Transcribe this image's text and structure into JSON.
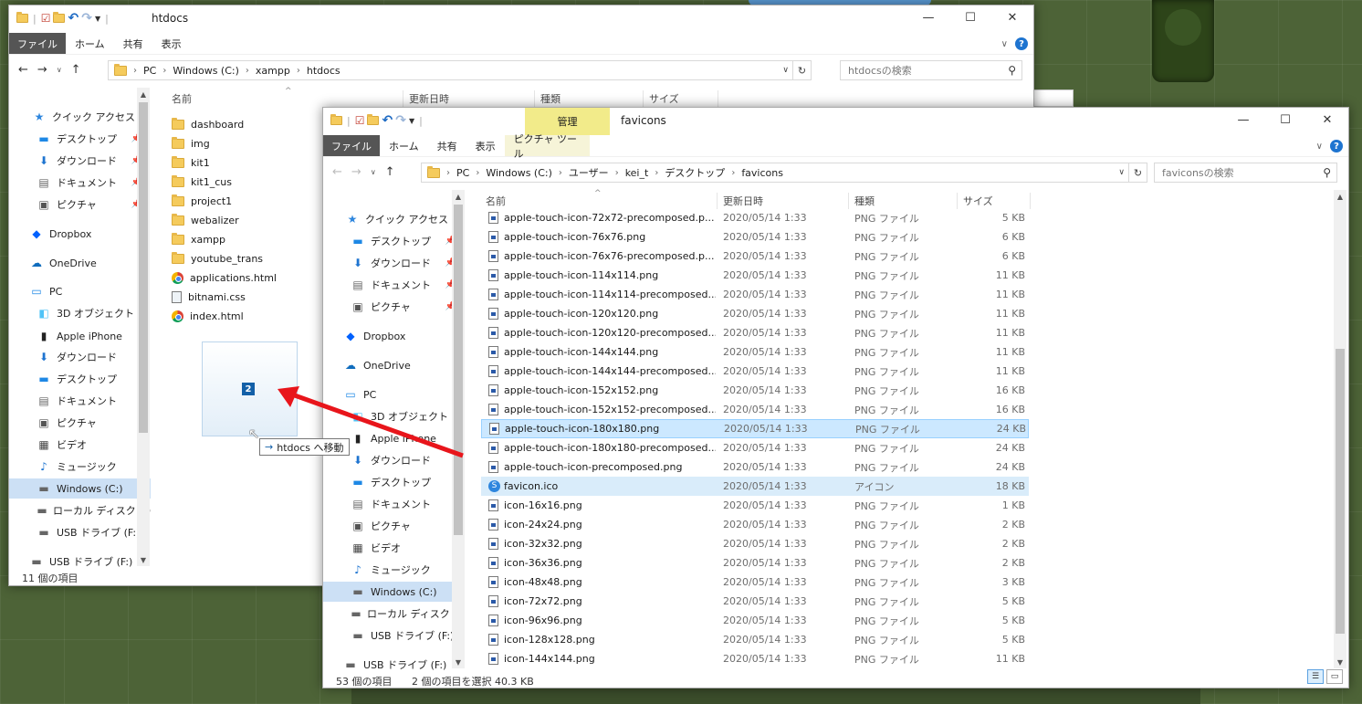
{
  "window_back": {
    "title": "htdocs",
    "ribbon_tabs": [
      "ファイル",
      "ホーム",
      "共有",
      "表示"
    ],
    "breadcrumb": [
      "PC",
      "Windows (C:)",
      "xampp",
      "htdocs"
    ],
    "search_placeholder": "htdocsの検索",
    "columns": [
      "名前",
      "更新日時",
      "種類",
      "サイズ"
    ],
    "nav": [
      {
        "label": "クイック アクセス",
        "icon": "star-icon",
        "pinned": false
      },
      {
        "label": "デスクトップ",
        "icon": "desktop-icon",
        "pinned": true
      },
      {
        "label": "ダウンロード",
        "icon": "download-icon",
        "pinned": true
      },
      {
        "label": "ドキュメント",
        "icon": "document-icon",
        "pinned": true
      },
      {
        "label": "ピクチャ",
        "icon": "picture-icon",
        "pinned": true
      },
      {
        "label": "Dropbox",
        "icon": "dropbox-icon",
        "pinned": false
      },
      {
        "label": "OneDrive",
        "icon": "onedrive-icon",
        "pinned": false
      },
      {
        "label": "PC",
        "icon": "pc-icon",
        "pinned": false
      },
      {
        "label": "3D オブジェクト",
        "icon": "cube-icon",
        "pinned": false
      },
      {
        "label": "Apple iPhone",
        "icon": "phone-icon",
        "pinned": false
      },
      {
        "label": "ダウンロード",
        "icon": "download-icon",
        "pinned": false
      },
      {
        "label": "デスクトップ",
        "icon": "desktop-icon",
        "pinned": false
      },
      {
        "label": "ドキュメント",
        "icon": "document-icon",
        "pinned": false
      },
      {
        "label": "ピクチャ",
        "icon": "picture-icon",
        "pinned": false
      },
      {
        "label": "ビデオ",
        "icon": "video-icon",
        "pinned": false
      },
      {
        "label": "ミュージック",
        "icon": "music-icon",
        "pinned": false
      },
      {
        "label": "Windows (C:)",
        "icon": "drive-icon",
        "pinned": false
      },
      {
        "label": "ローカル ディスク (D",
        "icon": "drive-icon",
        "pinned": false
      },
      {
        "label": "USB ドライブ (F:)",
        "icon": "usb-icon",
        "pinned": false
      },
      {
        "label": "USB ドライブ (F:)",
        "icon": "usb-icon",
        "pinned": false
      }
    ],
    "files": [
      {
        "name": "dashboard",
        "type": "folder"
      },
      {
        "name": "img",
        "type": "folder"
      },
      {
        "name": "kit1",
        "type": "folder"
      },
      {
        "name": "kit1_cus",
        "type": "folder"
      },
      {
        "name": "project1",
        "type": "folder"
      },
      {
        "name": "webalizer",
        "type": "folder"
      },
      {
        "name": "xampp",
        "type": "folder"
      },
      {
        "name": "youtube_trans",
        "type": "folder"
      },
      {
        "name": "applications.html",
        "type": "chrome"
      },
      {
        "name": "bitnami.css",
        "type": "css"
      },
      {
        "name": "index.html",
        "type": "chrome"
      }
    ],
    "status": "11 個の項目"
  },
  "window_front": {
    "title": "favicons",
    "manage_tab": "管理",
    "picture_tools_tab": "ピクチャ ツール",
    "ribbon_tabs": [
      "ファイル",
      "ホーム",
      "共有",
      "表示"
    ],
    "breadcrumb": [
      "PC",
      "Windows (C:)",
      "ユーザー",
      "kei_t",
      "デスクトップ",
      "favicons"
    ],
    "search_placeholder": "faviconsの検索",
    "columns": [
      "名前",
      "更新日時",
      "種類",
      "サイズ"
    ],
    "nav": [
      {
        "label": "クイック アクセス",
        "icon": "star-icon",
        "pinned": false
      },
      {
        "label": "デスクトップ",
        "icon": "desktop-icon",
        "pinned": true
      },
      {
        "label": "ダウンロード",
        "icon": "download-icon",
        "pinned": true
      },
      {
        "label": "ドキュメント",
        "icon": "document-icon",
        "pinned": true
      },
      {
        "label": "ピクチャ",
        "icon": "picture-icon",
        "pinned": true
      },
      {
        "label": "Dropbox",
        "icon": "dropbox-icon",
        "pinned": false
      },
      {
        "label": "OneDrive",
        "icon": "onedrive-icon",
        "pinned": false
      },
      {
        "label": "PC",
        "icon": "pc-icon",
        "pinned": false
      },
      {
        "label": "3D オブジェクト",
        "icon": "cube-icon",
        "pinned": false
      },
      {
        "label": "Apple iPhone",
        "icon": "phone-icon",
        "pinned": false
      },
      {
        "label": "ダウンロード",
        "icon": "download-icon",
        "pinned": false
      },
      {
        "label": "デスクトップ",
        "icon": "desktop-icon",
        "pinned": false
      },
      {
        "label": "ドキュメント",
        "icon": "document-icon",
        "pinned": false
      },
      {
        "label": "ピクチャ",
        "icon": "picture-icon",
        "pinned": false
      },
      {
        "label": "ビデオ",
        "icon": "video-icon",
        "pinned": false
      },
      {
        "label": "ミュージック",
        "icon": "music-icon",
        "pinned": false
      },
      {
        "label": "Windows (C:)",
        "icon": "drive-icon",
        "pinned": false
      },
      {
        "label": "ローカル ディスク (D",
        "icon": "drive-icon",
        "pinned": false
      },
      {
        "label": "USB ドライブ (F:)",
        "icon": "usb-icon",
        "pinned": false
      },
      {
        "label": "USB ドライブ (F:)",
        "icon": "usb-icon",
        "pinned": false
      }
    ],
    "files": [
      {
        "name": "apple-touch-icon-72x72-precomposed.p...",
        "date": "2020/05/14 1:33",
        "type": "PNG ファイル",
        "size": "5 KB",
        "icon": "png"
      },
      {
        "name": "apple-touch-icon-76x76.png",
        "date": "2020/05/14 1:33",
        "type": "PNG ファイル",
        "size": "6 KB",
        "icon": "png"
      },
      {
        "name": "apple-touch-icon-76x76-precomposed.p...",
        "date": "2020/05/14 1:33",
        "type": "PNG ファイル",
        "size": "6 KB",
        "icon": "png"
      },
      {
        "name": "apple-touch-icon-114x114.png",
        "date": "2020/05/14 1:33",
        "type": "PNG ファイル",
        "size": "11 KB",
        "icon": "png"
      },
      {
        "name": "apple-touch-icon-114x114-precomposed...",
        "date": "2020/05/14 1:33",
        "type": "PNG ファイル",
        "size": "11 KB",
        "icon": "png"
      },
      {
        "name": "apple-touch-icon-120x120.png",
        "date": "2020/05/14 1:33",
        "type": "PNG ファイル",
        "size": "11 KB",
        "icon": "png"
      },
      {
        "name": "apple-touch-icon-120x120-precomposed...",
        "date": "2020/05/14 1:33",
        "type": "PNG ファイル",
        "size": "11 KB",
        "icon": "png"
      },
      {
        "name": "apple-touch-icon-144x144.png",
        "date": "2020/05/14 1:33",
        "type": "PNG ファイル",
        "size": "11 KB",
        "icon": "png"
      },
      {
        "name": "apple-touch-icon-144x144-precomposed...",
        "date": "2020/05/14 1:33",
        "type": "PNG ファイル",
        "size": "11 KB",
        "icon": "png"
      },
      {
        "name": "apple-touch-icon-152x152.png",
        "date": "2020/05/14 1:33",
        "type": "PNG ファイル",
        "size": "16 KB",
        "icon": "png"
      },
      {
        "name": "apple-touch-icon-152x152-precomposed...",
        "date": "2020/05/14 1:33",
        "type": "PNG ファイル",
        "size": "16 KB",
        "icon": "png"
      },
      {
        "name": "apple-touch-icon-180x180.png",
        "date": "2020/05/14 1:33",
        "type": "PNG ファイル",
        "size": "24 KB",
        "icon": "png",
        "selected": true
      },
      {
        "name": "apple-touch-icon-180x180-precomposed...",
        "date": "2020/05/14 1:33",
        "type": "PNG ファイル",
        "size": "24 KB",
        "icon": "png"
      },
      {
        "name": "apple-touch-icon-precomposed.png",
        "date": "2020/05/14 1:33",
        "type": "PNG ファイル",
        "size": "24 KB",
        "icon": "png"
      },
      {
        "name": "favicon.ico",
        "date": "2020/05/14 1:33",
        "type": "アイコン",
        "size": "18 KB",
        "icon": "ico",
        "selected": true
      },
      {
        "name": "icon-16x16.png",
        "date": "2020/05/14 1:33",
        "type": "PNG ファイル",
        "size": "1 KB",
        "icon": "png"
      },
      {
        "name": "icon-24x24.png",
        "date": "2020/05/14 1:33",
        "type": "PNG ファイル",
        "size": "2 KB",
        "icon": "png"
      },
      {
        "name": "icon-32x32.png",
        "date": "2020/05/14 1:33",
        "type": "PNG ファイル",
        "size": "2 KB",
        "icon": "png"
      },
      {
        "name": "icon-36x36.png",
        "date": "2020/05/14 1:33",
        "type": "PNG ファイル",
        "size": "2 KB",
        "icon": "png"
      },
      {
        "name": "icon-48x48.png",
        "date": "2020/05/14 1:33",
        "type": "PNG ファイル",
        "size": "3 KB",
        "icon": "png"
      },
      {
        "name": "icon-72x72.png",
        "date": "2020/05/14 1:33",
        "type": "PNG ファイル",
        "size": "5 KB",
        "icon": "png"
      },
      {
        "name": "icon-96x96.png",
        "date": "2020/05/14 1:33",
        "type": "PNG ファイル",
        "size": "5 KB",
        "icon": "png"
      },
      {
        "name": "icon-128x128.png",
        "date": "2020/05/14 1:33",
        "type": "PNG ファイル",
        "size": "5 KB",
        "icon": "png"
      },
      {
        "name": "icon-144x144.png",
        "date": "2020/05/14 1:33",
        "type": "PNG ファイル",
        "size": "11 KB",
        "icon": "png"
      }
    ],
    "status_count": "53 個の項目",
    "status_selected": "2 個の項目を選択  40.3 KB"
  },
  "drag": {
    "count": "2",
    "tooltip": "htdocs へ移動"
  },
  "colors": {
    "selection": "#cce8ff",
    "accent": "#1e74d0",
    "manage_tab": "#f2eb8a",
    "drag_arrow": "#e8151b"
  }
}
